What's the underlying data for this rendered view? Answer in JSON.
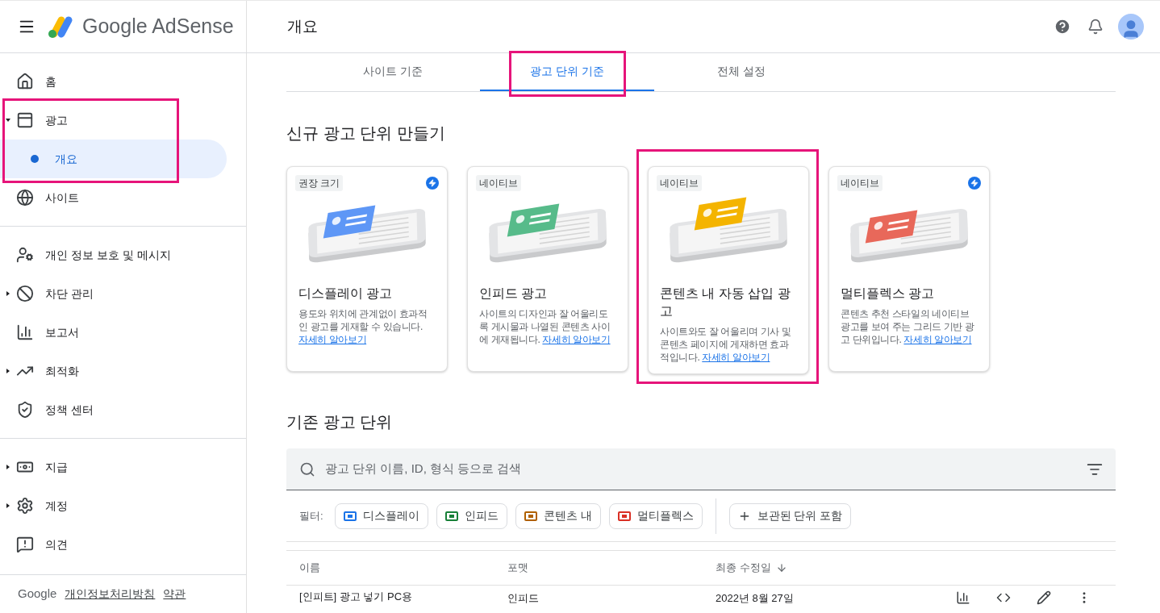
{
  "header": {
    "product": "Google AdSense",
    "page_title": "개요"
  },
  "sidebar": {
    "groups": [
      {
        "items": [
          {
            "label": "홈",
            "selected": false,
            "highlighted": false
          },
          {
            "label": "광고",
            "expanded": true,
            "selected": false,
            "highlighted": true,
            "children": [
              {
                "label": "개요",
                "selected": true
              }
            ]
          },
          {
            "label": "사이트",
            "selected": false,
            "highlighted": false
          }
        ]
      },
      {
        "items": [
          {
            "label": "개인 정보 보호 및 메시지",
            "selected": false,
            "highlighted": false
          },
          {
            "label": "차단 관리",
            "expanded": false,
            "selected": false,
            "highlighted": false
          },
          {
            "label": "보고서",
            "selected": false,
            "highlighted": false
          },
          {
            "label": "최적화",
            "expanded": false,
            "selected": false,
            "highlighted": false
          },
          {
            "label": "정책 센터",
            "selected": false,
            "highlighted": false
          }
        ]
      },
      {
        "items": [
          {
            "label": "지급",
            "expanded": false,
            "selected": false,
            "highlighted": false
          },
          {
            "label": "계정",
            "expanded": false,
            "selected": false,
            "highlighted": false
          },
          {
            "label": "의견",
            "selected": false,
            "highlighted": false
          }
        ]
      }
    ],
    "footer": {
      "brand": "Google",
      "links": [
        "개인정보처리방침",
        "약관"
      ]
    }
  },
  "tabs": [
    {
      "label": "사이트 기준",
      "selected": false,
      "highlighted": false
    },
    {
      "label": "광고 단위 기준",
      "selected": true,
      "highlighted": true
    },
    {
      "label": "전체 설정",
      "selected": false,
      "highlighted": false
    }
  ],
  "new_units": {
    "title": "신규 광고 단위 만들기",
    "cards": [
      {
        "badge": "권장 크기",
        "amp": true,
        "color": "#5e97f6",
        "title": "디스플레이 광고",
        "description": "용도와 위치에 관계없이 효과적인 광고를 게재할 수 있습니다.",
        "link": "자세히 알아보기",
        "highlighted": false
      },
      {
        "badge": "네이티브",
        "amp": false,
        "color": "#57bb8a",
        "title": "인피드 광고",
        "description": "사이트의 디자인과 잘 어울리도록 게시물과 나열된 콘텐츠 사이에 게재됩니다.",
        "link": "자세히 알아보기",
        "highlighted": false
      },
      {
        "badge": "네이티브",
        "amp": false,
        "color": "#f4b400",
        "title": "콘텐츠 내 자동 삽입 광고",
        "description": "사이트와도 잘 어울리며 기사 및 콘텐츠 페이지에 게재하면 효과적입니다.",
        "link": "자세히 알아보기",
        "highlighted": true
      },
      {
        "badge": "네이티브",
        "amp": true,
        "color": "#e8685a",
        "title": "멀티플렉스 광고",
        "description": "콘텐츠 추천 스타일의 네이티브 광고를 보여 주는 그리드 기반 광고 단위입니다.",
        "link": "자세히 알아보기",
        "highlighted": false
      }
    ]
  },
  "existing_units": {
    "title": "기존 광고 단위",
    "search": {
      "placeholder": "광고 단위 이름, ID, 형식 등으로 검색"
    },
    "filter_label": "필터:",
    "filters": [
      {
        "label": "디스플레이",
        "color": "#1a73e8"
      },
      {
        "label": "인피드",
        "color": "#188038"
      },
      {
        "label": "콘텐츠 내",
        "color": "#b06000"
      },
      {
        "label": "멀티플렉스",
        "color": "#d93025"
      }
    ],
    "archived_toggle": "보관된 단위 포함",
    "columns": [
      {
        "label": "이름",
        "sorted": false
      },
      {
        "label": "포맷",
        "sorted": false
      },
      {
        "label": "최종 수정일",
        "sorted": true
      }
    ],
    "rows": [
      {
        "name": "[인피트] 광고 넣기 PC용",
        "format": "인피드",
        "modified": "2022년 8월 27일"
      }
    ]
  }
}
